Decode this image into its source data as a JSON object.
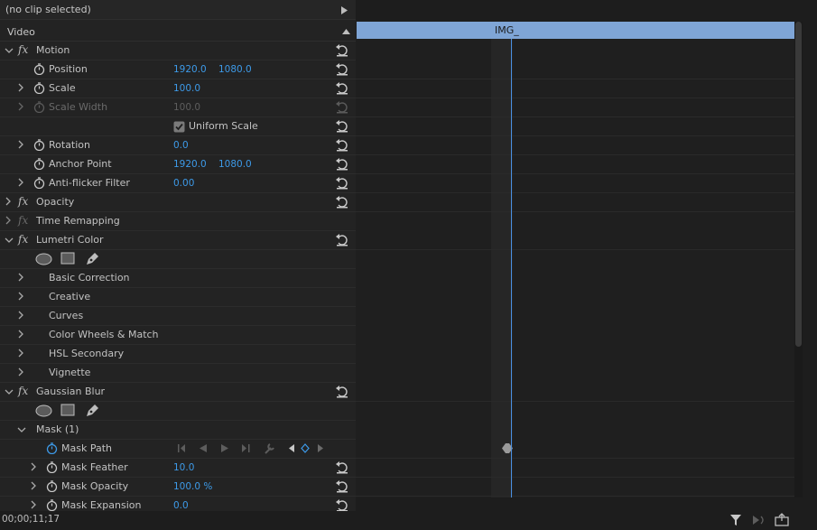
{
  "header": {
    "clip_label": "(no clip selected)",
    "section_label": "Video"
  },
  "effects": {
    "motion": {
      "label": "Motion",
      "position": {
        "label": "Position",
        "x": "1920.0",
        "y": "1080.0"
      },
      "scale": {
        "label": "Scale",
        "value": "100.0"
      },
      "scale_width": {
        "label": "Scale Width",
        "value": "100.0"
      },
      "uniform_scale": {
        "label": "Uniform Scale",
        "checked": true
      },
      "rotation": {
        "label": "Rotation",
        "value": "0.0"
      },
      "anchor_point": {
        "label": "Anchor Point",
        "x": "1920.0",
        "y": "1080.0"
      },
      "anti_flicker": {
        "label": "Anti-flicker Filter",
        "value": "0.00"
      }
    },
    "opacity": {
      "label": "Opacity"
    },
    "time_remapping": {
      "label": "Time Remapping"
    },
    "lumetri": {
      "label": "Lumetri Color",
      "sections": [
        "Basic Correction",
        "Creative",
        "Curves",
        "Color Wheels & Match",
        "HSL Secondary",
        "Vignette"
      ]
    },
    "gaussian_blur": {
      "label": "Gaussian Blur",
      "mask": {
        "label": "Mask (1)",
        "mask_path": {
          "label": "Mask Path"
        },
        "mask_feather": {
          "label": "Mask Feather",
          "value": "10.0"
        },
        "mask_opacity": {
          "label": "Mask Opacity",
          "value": "100.0 %"
        },
        "mask_expansion": {
          "label": "Mask Expansion",
          "value": "0.0"
        }
      }
    }
  },
  "timeline": {
    "clip_name": "IMG_"
  },
  "footer": {
    "timecode": "00;00;11;17"
  },
  "colors": {
    "accent_blue": "#3d9ae8",
    "clip_bar": "#7fa5d6",
    "playhead": "#4a90e2"
  },
  "icons": [
    "chevron-right-icon",
    "stopwatch-icon",
    "reset-icon",
    "ellipse-mask-icon",
    "rect-mask-icon",
    "pen-mask-icon",
    "filter-icon",
    "export-icon"
  ]
}
